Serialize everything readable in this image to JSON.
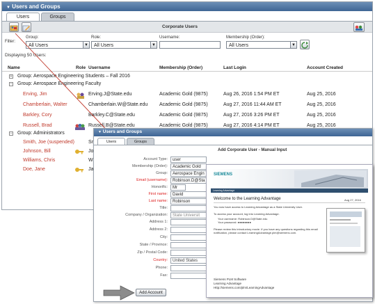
{
  "main": {
    "title": "Users and Groups",
    "tabs": [
      "Users",
      "Groups"
    ],
    "panel_title": "Corporate Users",
    "filter_label": "Filter:",
    "filters": [
      {
        "label": "Group:",
        "value": "All Users"
      },
      {
        "label": "Role:",
        "value": "All Users"
      },
      {
        "label": "Username:",
        "value": ""
      },
      {
        "label": "Membership (Order):",
        "value": "All Users"
      }
    ],
    "displaying": "Displaying 50 Users:",
    "columns": [
      "Name",
      "Role",
      "Username",
      "Membership (Order)",
      "Last Login",
      "Account Created"
    ],
    "groups": [
      {
        "label": "Group: Aerospace Engineering Students – Fall 2016",
        "expander": "+"
      },
      {
        "label": "Group: Aerospace Engineering Faculty",
        "expander": "–"
      }
    ],
    "faculty_rows": [
      {
        "name": "Erving, Jim",
        "username": "Erving.J@State.edu",
        "membership": "Academic Gold (9875)",
        "last_login": "Aug 26, 2016 1:54 PM ET",
        "created": "Aug 25, 2016"
      },
      {
        "name": "Chamberlain, Walter",
        "username": "Chamberlain.W@State.edu",
        "membership": "Academic Gold (9875)",
        "last_login": "Aug 27, 2016 11:44 AM ET",
        "created": "Aug 25, 2016"
      },
      {
        "name": "Barkley, Cory",
        "username": "Barkley.C@State.edu",
        "membership": "Academic Gold (9875)",
        "last_login": "Aug 27, 2016  3:26 PM ET",
        "created": "Aug 25, 2016"
      },
      {
        "name": "Russell, Brad",
        "username": "Russell.B@State.edu",
        "membership": "Academic Gold (9875)",
        "last_login": "Aug 27, 2016  4:14 PM ET",
        "created": "Aug 25, 2016"
      }
    ],
    "admin_group": {
      "label": "Group: Administrators",
      "expander": "–"
    },
    "admin_rows": [
      {
        "name": "Smith, Joe (suspended)",
        "username": "Smi"
      },
      {
        "name": "Johnson, Bill",
        "username": "Joh"
      },
      {
        "name": "Williams, Chris",
        "username": "Wil"
      },
      {
        "name": "Doe, Jane",
        "username": "Jane"
      }
    ]
  },
  "dialog": {
    "title": "Users and Groups",
    "tabs": [
      "Users",
      "Groups"
    ],
    "heading": "Add Corporate User - Manual Input",
    "fields": [
      {
        "label": "Account Type:",
        "value": "user",
        "required": false
      },
      {
        "label": "Membership (Order):",
        "value": "Academic Gold",
        "required": false
      },
      {
        "label": "Group:",
        "value": "Aerospace Engin",
        "required": false
      },
      {
        "label": "Email (username):",
        "value": "Robinson.D@Sta",
        "required": true
      },
      {
        "label": "Honorific:",
        "value": "Mr",
        "required": false
      },
      {
        "label": "First name:",
        "value": "David",
        "required": true
      },
      {
        "label": "Last name:",
        "value": "Robinson",
        "required": true
      },
      {
        "label": "Title:",
        "value": "",
        "required": false
      },
      {
        "label": "Company / Organization:",
        "value": "State Universit",
        "required": false
      },
      {
        "label": "Address 1:",
        "value": "",
        "required": false
      },
      {
        "label": "Address 2:",
        "value": "",
        "required": false
      },
      {
        "label": "City:",
        "value": "",
        "required": false
      },
      {
        "label": "State / Province:",
        "value": "",
        "required": false
      },
      {
        "label": "Zip / Postal Code:",
        "value": "",
        "required": false
      },
      {
        "label": "Country:",
        "value": "United States",
        "required": true
      },
      {
        "label": "Phone:",
        "value": "",
        "required": false
      },
      {
        "label": "Fax:",
        "value": "",
        "required": false
      }
    ],
    "add_button": "Add Account"
  },
  "email": {
    "brand": "SIEMENS",
    "subbar": "Learning Advantage",
    "title": "Welcome to the Learning Advantage",
    "date": "Aug 27, 2016",
    "line1": "You now have access to Learning Advantage as a State University User.",
    "line2": "To access your account, log into Learning Advantage.",
    "username_line": "Your username: Robinson.D@State.edu",
    "password_line": "Your password: ●●●●●●●●",
    "line3": "Please review this introductory movie. If you have any questions regarding this email notification, please contact LearningAdvantage.plm@siemens.com.",
    "footer1": "Siemens PLM Software",
    "footer2": "Learning Advantage",
    "footer3": "Http://siemens.com/plm/LearningAdvantage"
  },
  "colors": {
    "accent": "#3e6594",
    "required": "#c0392b",
    "arrow": "#c0392b"
  }
}
